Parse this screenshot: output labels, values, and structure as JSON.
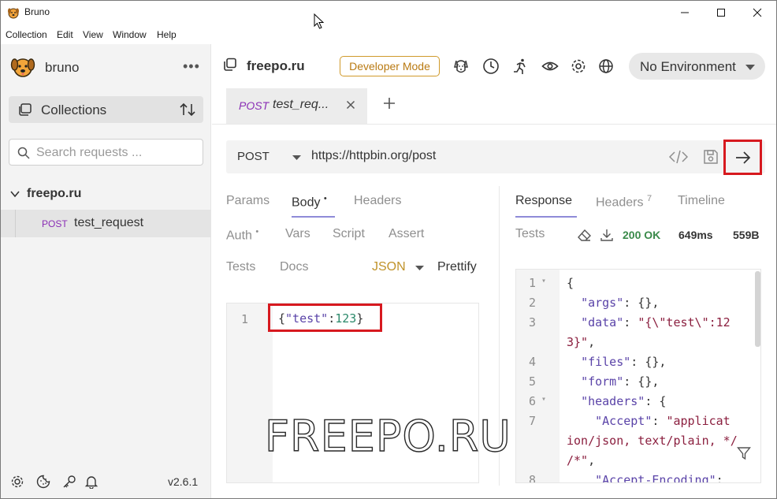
{
  "window": {
    "title": "Bruno",
    "menu": [
      "Collection",
      "Edit",
      "View",
      "Window",
      "Help"
    ]
  },
  "sidebar": {
    "brand": "bruno",
    "more_icon": "more-dots-icon",
    "collections_label": "Collections",
    "search_placeholder": "Search requests ...",
    "collection_name": "freepo.ru",
    "request": {
      "method": "POST",
      "name": "test_request"
    },
    "version": "v2.6.1"
  },
  "header": {
    "collection_title": "freepo.ru",
    "dev_mode_label": "Developer Mode",
    "environment": "No Environment"
  },
  "tabs": [
    {
      "method": "POST",
      "name": "test_req..."
    }
  ],
  "url_bar": {
    "method": "POST",
    "url": "https://httpbin.org/post"
  },
  "request_tabs": {
    "params": "Params",
    "body": "Body",
    "headers": "Headers",
    "auth": "Auth",
    "vars": "Vars",
    "script": "Script",
    "assert": "Assert",
    "tests": "Tests",
    "docs": "Docs",
    "dot": "•",
    "body_mode": "JSON",
    "prettify": "Prettify"
  },
  "request_body": {
    "line_no": "1",
    "brace_open": "{",
    "key": "\"test\"",
    "colon": ":",
    "value": "123",
    "brace_close": "}"
  },
  "response_tabs": {
    "response": "Response",
    "headers": "Headers",
    "headers_count": "7",
    "timeline": "Timeline",
    "tests": "Tests"
  },
  "response_meta": {
    "status": "200 OK",
    "time": "649ms",
    "size": "559B"
  },
  "response_body": [
    {
      "n": "1",
      "fold": true,
      "parts": [
        [
          "p",
          "{"
        ]
      ]
    },
    {
      "n": "2",
      "fold": false,
      "parts": [
        [
          "p",
          "  "
        ],
        [
          "k",
          "\"args\""
        ],
        [
          "p",
          ": {},"
        ]
      ]
    },
    {
      "n": "3",
      "fold": false,
      "parts": [
        [
          "p",
          "  "
        ],
        [
          "k",
          "\"data\""
        ],
        [
          "p",
          ": "
        ],
        [
          "s",
          "\"{\\\"test\\\":12"
        ]
      ]
    },
    {
      "n": "",
      "fold": false,
      "parts": [
        [
          "s",
          "3}\""
        ],
        [
          "p",
          ","
        ]
      ]
    },
    {
      "n": "4",
      "fold": false,
      "parts": [
        [
          "p",
          "  "
        ],
        [
          "k",
          "\"files\""
        ],
        [
          "p",
          ": {},"
        ]
      ]
    },
    {
      "n": "5",
      "fold": false,
      "parts": [
        [
          "p",
          "  "
        ],
        [
          "k",
          "\"form\""
        ],
        [
          "p",
          ": {},"
        ]
      ]
    },
    {
      "n": "6",
      "fold": true,
      "parts": [
        [
          "p",
          "  "
        ],
        [
          "k",
          "\"headers\""
        ],
        [
          "p",
          ": {"
        ]
      ]
    },
    {
      "n": "7",
      "fold": false,
      "parts": [
        [
          "p",
          "    "
        ],
        [
          "k",
          "\"Accept\""
        ],
        [
          "p",
          ": "
        ],
        [
          "s",
          "\"applicat"
        ]
      ]
    },
    {
      "n": "",
      "fold": false,
      "parts": [
        [
          "s",
          "ion/json, text/plain, */"
        ]
      ]
    },
    {
      "n": "",
      "fold": false,
      "parts": [
        [
          "s",
          "/*\""
        ],
        [
          "p",
          ","
        ]
      ]
    },
    {
      "n": "8",
      "fold": false,
      "parts": [
        [
          "p",
          "    "
        ],
        [
          "k",
          "\"Accept-Encoding\""
        ],
        [
          "p",
          ":"
        ]
      ]
    }
  ],
  "watermark": "FREEPO.RU",
  "colors": {
    "post_method": "#8a2eb5",
    "dev_mode": "#b97a12",
    "status_ok": "#3a8a4a",
    "highlight_box": "#d7191f",
    "active_underline": "#8f8bd8"
  }
}
